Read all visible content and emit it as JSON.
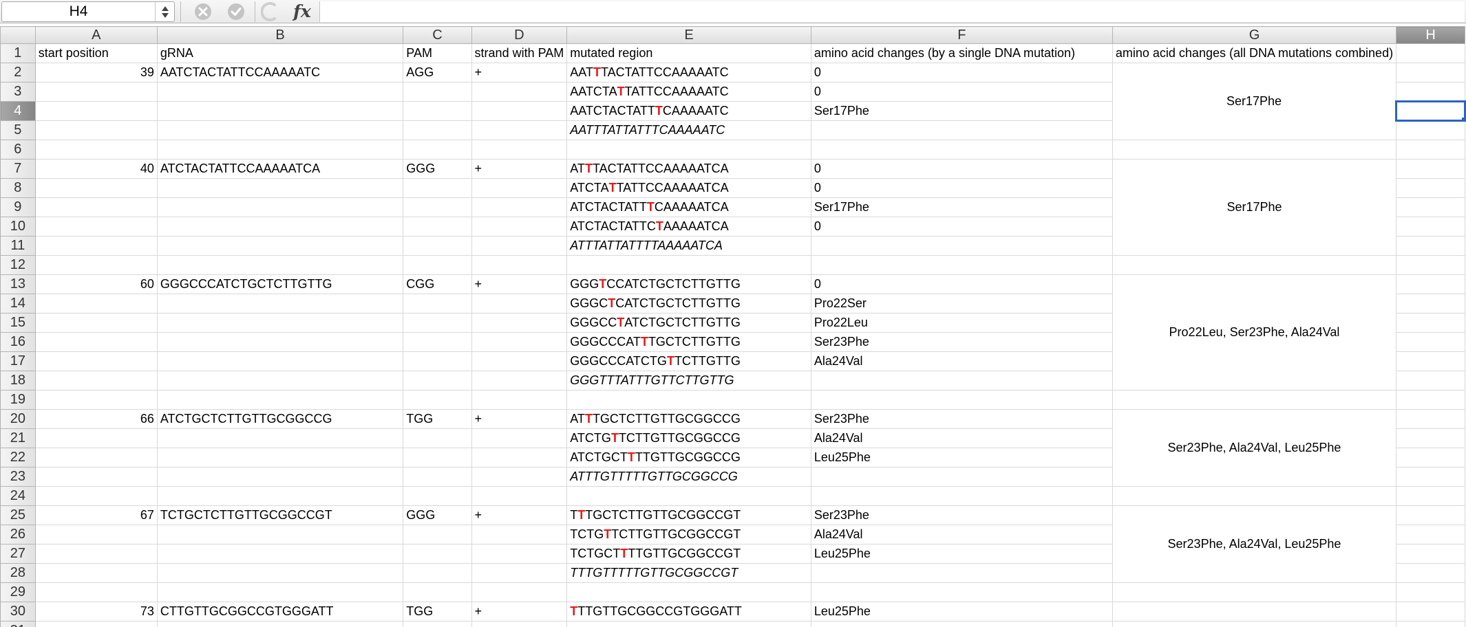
{
  "formula_bar": {
    "name_box": "H4",
    "cancel_icon": "close-circle-icon",
    "accept_icon": "check-circle-icon",
    "function_icon": "function-icon",
    "fx_label": "fx",
    "formula": ""
  },
  "sheet": {
    "columns": [
      "A",
      "B",
      "C",
      "D",
      "E",
      "F",
      "G",
      "H"
    ],
    "selected_cell": "H4",
    "mutation_color": "#e41a1a",
    "selection_color": "#2a64c5",
    "headers": {
      "A": "start position",
      "B": "gRNA",
      "C": "PAM",
      "D": "strand with PAM",
      "E": "mutated region",
      "F": "amino acid changes (by a single DNA mutation)",
      "G": "amino acid changes (all DNA mutations combined)",
      "H": ""
    },
    "rows": [
      {
        "n": 2,
        "A": "39",
        "B": "AATCTACTATTCCAAAAATC",
        "C": "AGG",
        "D": "+",
        "E": [
          "AAT",
          "T",
          "TACTATTCCAAAAATC"
        ],
        "F": "0"
      },
      {
        "n": 3,
        "E": [
          "AATCTA",
          "T",
          "TATTCCAAAAATC"
        ],
        "F": "0"
      },
      {
        "n": 4,
        "E": [
          "AATCTACTATT",
          "T",
          "CAAAAATC"
        ],
        "F": "Ser17Phe"
      },
      {
        "n": 5,
        "E_combined": "AATTTATTATTTCAAAAATC"
      },
      {
        "n": 6
      },
      {
        "n": 7,
        "A": "40",
        "B": "ATCTACTATTCCAAAAATCA",
        "C": "GGG",
        "D": "+",
        "E": [
          "AT",
          "T",
          "TACTATTCCAAAAATCA"
        ],
        "F": "0"
      },
      {
        "n": 8,
        "E": [
          "ATCTA",
          "T",
          "TATTCCAAAAATCA"
        ],
        "F": "0"
      },
      {
        "n": 9,
        "E": [
          "ATCTACTATT",
          "T",
          "CAAAAATCA"
        ],
        "F": "Ser17Phe"
      },
      {
        "n": 10,
        "E": [
          "ATCTACTATTC",
          "T",
          "AAAAATCA"
        ],
        "F": "0"
      },
      {
        "n": 11,
        "E_combined": "ATTTATTATTTTAAAAATCA"
      },
      {
        "n": 12
      },
      {
        "n": 13,
        "A": "60",
        "B": "GGGCCCATCTGCTCTTGTTG",
        "C": "CGG",
        "D": "+",
        "E": [
          "GGG",
          "T",
          "CCATCTGCTCTTGTTG"
        ],
        "F": "0"
      },
      {
        "n": 14,
        "E": [
          "GGGC",
          "T",
          "CATCTGCTCTTGTTG"
        ],
        "F": "Pro22Ser"
      },
      {
        "n": 15,
        "E": [
          "GGGCC",
          "T",
          "ATCTGCTCTTGTTG"
        ],
        "F": "Pro22Leu"
      },
      {
        "n": 16,
        "E": [
          "GGGCCCAT",
          "T",
          "TGCTCTTGTTG"
        ],
        "F": "Ser23Phe"
      },
      {
        "n": 17,
        "E": [
          "GGGCCCATCTG",
          "T",
          "TCTTGTTG"
        ],
        "F": "Ala24Val"
      },
      {
        "n": 18,
        "E_combined": "GGGTTTATTTGTTCTTGTTG"
      },
      {
        "n": 19
      },
      {
        "n": 20,
        "A": "66",
        "B": "ATCTGCTCTTGTTGCGGCCG",
        "C": "TGG",
        "D": "+",
        "E": [
          "AT",
          "T",
          "TGCTCTTGTTGCGGCCG"
        ],
        "F": "Ser23Phe"
      },
      {
        "n": 21,
        "E": [
          "ATCTG",
          "T",
          "TCTTGTTGCGGCCG"
        ],
        "F": "Ala24Val"
      },
      {
        "n": 22,
        "E": [
          "ATCTGCT",
          "T",
          "TTGTTGCGGCCG"
        ],
        "F": "Leu25Phe"
      },
      {
        "n": 23,
        "E_combined": "ATTTGTTTTTGTTGCGGCCG"
      },
      {
        "n": 24
      },
      {
        "n": 25,
        "A": "67",
        "B": "TCTGCTCTTGTTGCGGCCGT",
        "C": "GGG",
        "D": "+",
        "E": [
          "T",
          "T",
          "TGCTCTTGTTGCGGCCGT"
        ],
        "F": "Ser23Phe"
      },
      {
        "n": 26,
        "E": [
          "TCTG",
          "T",
          "TCTTGTTGCGGCCGT"
        ],
        "F": "Ala24Val"
      },
      {
        "n": 27,
        "E": [
          "TCTGCT",
          "T",
          "TTGTTGCGGCCGT"
        ],
        "F": "Leu25Phe"
      },
      {
        "n": 28,
        "E_combined": "TTTGTTTTTGTTGCGGCCGT"
      },
      {
        "n": 29
      },
      {
        "n": 30,
        "A": "73",
        "B": "CTTGTTGCGGCCGTGGGATT",
        "C": "TGG",
        "D": "+",
        "E": [
          "",
          "T",
          "TTGTTGCGGCCGTGGGATT"
        ],
        "F": "Leu25Phe"
      },
      {
        "n": 31
      }
    ],
    "merged_g": [
      {
        "start": 2,
        "span": 4,
        "text": "Ser17Phe"
      },
      {
        "start": 7,
        "span": 5,
        "text": "Ser17Phe"
      },
      {
        "start": 13,
        "span": 6,
        "text": "Pro22Leu, Ser23Phe, Ala24Val"
      },
      {
        "start": 20,
        "span": 4,
        "text": "Ser23Phe, Ala24Val, Leu25Phe"
      },
      {
        "start": 25,
        "span": 4,
        "text": "Ser23Phe, Ala24Val, Leu25Phe"
      }
    ]
  }
}
